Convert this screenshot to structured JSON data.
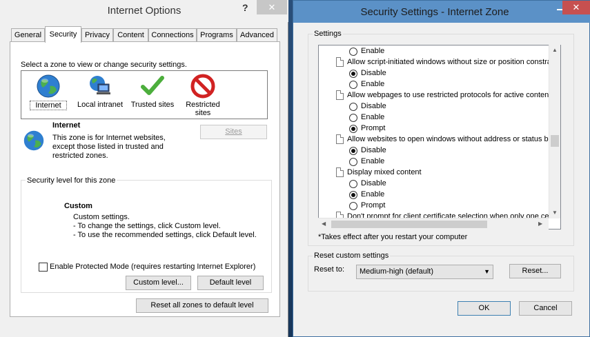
{
  "internet_options": {
    "title": "Internet Options",
    "help_glyph": "?",
    "close_glyph": "✕",
    "tabs": [
      {
        "label": "General"
      },
      {
        "label": "Security"
      },
      {
        "label": "Privacy"
      },
      {
        "label": "Content"
      },
      {
        "label": "Connections"
      },
      {
        "label": "Programs"
      },
      {
        "label": "Advanced"
      }
    ],
    "zone_prompt": "Select a zone to view or change security settings.",
    "zones": [
      {
        "label": "Internet",
        "icon": "globe-icon"
      },
      {
        "label": "Local intranet",
        "icon": "intranet-icon"
      },
      {
        "label": "Trusted sites",
        "icon": "checkmark-icon"
      },
      {
        "label": "Restricted",
        "label2": "sites",
        "icon": "no-entry-icon"
      }
    ],
    "zone_info": {
      "title": "Internet",
      "lines": [
        "This zone is for Internet websites,",
        "except those listed in trusted and",
        "restricted zones."
      ]
    },
    "sites_button": "Sites",
    "level_group_label": "Security level for this zone",
    "custom": {
      "title": "Custom",
      "lines": [
        "Custom settings.",
        "- To change the settings, click Custom level.",
        "- To use the recommended settings, click Default level."
      ]
    },
    "protected_mode_label": "Enable Protected Mode (requires restarting Internet Explorer)",
    "custom_level_button": "Custom level...",
    "default_level_button": "Default level",
    "reset_all_button": "Reset all zones to default level"
  },
  "security_settings": {
    "title": "Security Settings - Internet Zone",
    "close_glyph": "✕",
    "settings_label": "Settings",
    "items": [
      {
        "type": "option",
        "label": "Enable",
        "selected": false
      },
      {
        "type": "heading",
        "label": "Allow script-initiated windows without size or position constra"
      },
      {
        "type": "option",
        "label": "Disable",
        "selected": true
      },
      {
        "type": "option",
        "label": "Enable",
        "selected": false
      },
      {
        "type": "heading",
        "label": "Allow webpages to use restricted protocols for active conten"
      },
      {
        "type": "option",
        "label": "Disable",
        "selected": false
      },
      {
        "type": "option",
        "label": "Enable",
        "selected": false
      },
      {
        "type": "option",
        "label": "Prompt",
        "selected": true
      },
      {
        "type": "heading",
        "label": "Allow websites to open windows without address or status ba"
      },
      {
        "type": "option",
        "label": "Disable",
        "selected": true
      },
      {
        "type": "option",
        "label": "Enable",
        "selected": false
      },
      {
        "type": "heading",
        "label": "Display mixed content"
      },
      {
        "type": "option",
        "label": "Disable",
        "selected": false
      },
      {
        "type": "option",
        "label": "Enable",
        "selected": true
      },
      {
        "type": "option",
        "label": "Prompt",
        "selected": false
      },
      {
        "type": "heading",
        "label": "Don't prompt for client certificate selection when only one ce"
      }
    ],
    "restart_note": "*Takes effect after you restart your computer",
    "reset_group_label": "Reset custom settings",
    "reset_to_label": "Reset to:",
    "reset_to_value": "Medium-high (default)",
    "reset_button": "Reset...",
    "ok_button": "OK",
    "cancel_button": "Cancel"
  },
  "colors": {
    "accent_title": "#5b91c7",
    "close_red": "#c75050",
    "desktop": "#1d3f66"
  }
}
